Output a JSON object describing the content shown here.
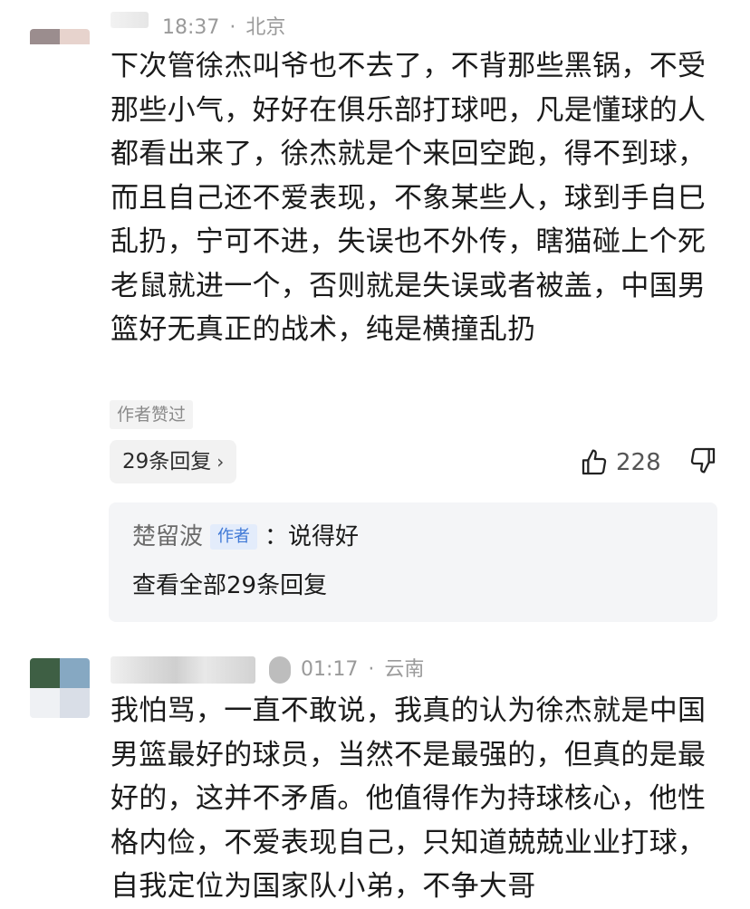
{
  "comments": [
    {
      "time": "18:37",
      "location": "北京",
      "content": "下次管徐杰叫爷也不去了，不背那些黑锅，不受那些小气，好好在俱乐部打球吧，凡是懂球的人都看出来了，徐杰就是个来回空跑，得不到球，而且自己还不爱表现，不象某些人，球到手自巳乱扔，宁可不进，失误也不外传，瞎猫碰上个死老鼠就进一个，否则就是失误或者被盖，中国男篮好无真正的战术，纯是横撞乱扔",
      "author_liked_tag": "作者赞过",
      "replies_label": "29条回复",
      "like_count": "228",
      "reply_preview": {
        "author": "楚留波",
        "badge": "作者",
        "text": "：说得好",
        "view_all": "查看全部29条回复"
      }
    },
    {
      "time": "01:17",
      "location": "云南",
      "content": "我怕骂，一直不敢说，我真的认为徐杰就是中国男篮最好的球员，当然不是最强的，但真的是最好的，这并不矛盾。他值得作为持球核心，他性格内俭，不爱表现自己，只知道兢兢业业打球，自我定位为国家队小弟，不争大哥"
    }
  ],
  "colors": {
    "avatar1": [
      "#9b8d8e",
      "#e7d3cd",
      "#ffffff",
      "#ffffff"
    ],
    "avatar2": [
      "#3e5f44",
      "#86a8c2",
      "#eff1f4",
      "#d9dee7"
    ],
    "badge": "#3f79d6"
  },
  "separator": "·",
  "icons": [
    "thumbs-up-icon",
    "thumbs-down-icon",
    "chevron-right-icon"
  ]
}
